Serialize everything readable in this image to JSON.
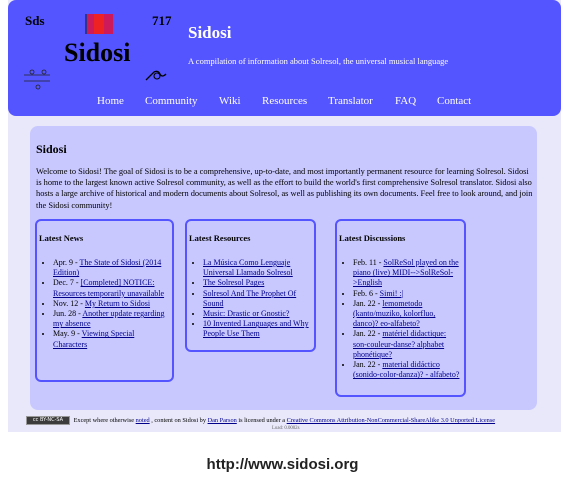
{
  "header": {
    "logo_abbr": "Sds",
    "logo_number": "717",
    "logo_name": "Sidosi",
    "site_title": "Sidosi",
    "tagline": "A compilation of information about Solresol, the universal musical language",
    "colors": {
      "header": "#5555ff",
      "content": "#c8c8ff",
      "page": "#e8e8fa"
    }
  },
  "nav": [
    {
      "label": "Home"
    },
    {
      "label": "Community"
    },
    {
      "label": "Wiki"
    },
    {
      "label": "Resources"
    },
    {
      "label": "Translator"
    },
    {
      "label": "FAQ"
    },
    {
      "label": "Contact"
    }
  ],
  "main": {
    "title": "Sidosi",
    "intro": "Welcome to Sidosi! The goal of Sidosi is to be a comprehensive, up-to-date, and most importantly permanent resource for learning Solresol. Sidosi is home to the largest known active Solresol community, as well as the effort to build the world's first comprehensive Solresol translator. Sidosi also hosts a large archive of historical and modern documents about Solresol, as well as publishing its own documents. Feel free to look around, and join the Sidosi community!"
  },
  "news": {
    "title": "Latest News",
    "items": [
      {
        "date": "Apr. 9 - ",
        "link": "The State of Sidosi (2014 Edition)"
      },
      {
        "date": "Dec. 7 - ",
        "link": "[Completed] NOTICE: Resources temporarily unavailable"
      },
      {
        "date": "Nov. 12 - ",
        "link": "My Return to Sidosi"
      },
      {
        "date": "Jun. 28 - ",
        "link": "Another update regarding my absence"
      },
      {
        "date": "May. 9 - ",
        "link": "Viewing Special Characters"
      }
    ]
  },
  "resources": {
    "title": "Latest Resources",
    "items": [
      {
        "link": "La Música Como Lenguaje Universal Llamado Solresol"
      },
      {
        "link": "The Solresol Pages"
      },
      {
        "link": "Solresol And The Prophet Of Sound"
      },
      {
        "link": "Music: Drastic or Gnostic?"
      },
      {
        "link": "10 Invented Languages and Why People Use Them"
      }
    ]
  },
  "discussions": {
    "title": "Latest Discussions",
    "items": [
      {
        "date": "Feb. 11 - ",
        "link": "SolReSol played on the piano (live) MIDI-->SolReSol->English"
      },
      {
        "date": "Feb. 6 - ",
        "link": "Simi! :|"
      },
      {
        "date": "Jan. 22 - ",
        "link": "lemometodo (kanto/muziko, kolorfluo, danco)? eo-alfabeto?"
      },
      {
        "date": "Jan. 22 - ",
        "link": "matériel didactique: son-couleur-danse? alphabet phonétique?"
      },
      {
        "date": "Jan. 22 - ",
        "link": "material didáctico (sonido-color-danza)? - alfabeto?"
      }
    ]
  },
  "footer": {
    "badge": "cc BY-NC-SA",
    "text1": "Except where otherwise ",
    "link1": "noted",
    "text2": ", content on Sidosi by ",
    "link2": "Dan Parson",
    "text3": " is licensed under a ",
    "link3": "Creative Commons Attribution-NonCommercial-ShareAlike 3.0 Unported License",
    "under": "Load: 0.0002s"
  },
  "caption": {
    "url": "http://www.sidosi.org"
  }
}
